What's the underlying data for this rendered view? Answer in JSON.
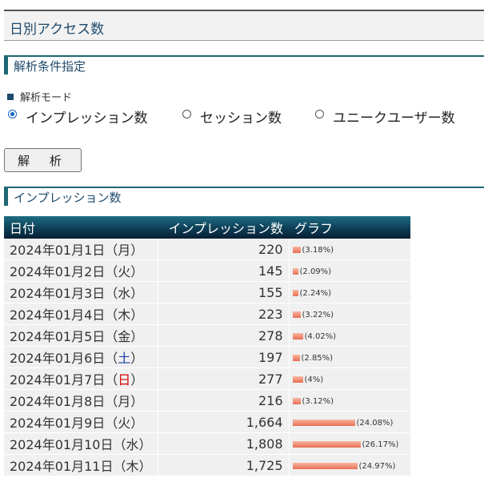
{
  "header": {
    "title": "日別アクセス数"
  },
  "conditions": {
    "heading": "解析条件指定",
    "mode_label": "解析モード",
    "modes": [
      {
        "label": "インプレッション数",
        "checked": true
      },
      {
        "label": "セッション数",
        "checked": false
      },
      {
        "label": "ユニークユーザー数",
        "checked": false
      }
    ],
    "analyze_button": "解 析"
  },
  "results": {
    "heading": "インプレッション数",
    "columns": [
      "日付",
      "インプレッション数",
      "グラフ"
    ],
    "rows": [
      {
        "date": "2024年01月1日（",
        "dow": "月",
        "dow_type": "weekday",
        "close": "）",
        "value": "220",
        "pct_text": "(3.18%)",
        "pct": 3.18
      },
      {
        "date": "2024年01月2日（",
        "dow": "火",
        "dow_type": "weekday",
        "close": "）",
        "value": "145",
        "pct_text": "(2.09%)",
        "pct": 2.09
      },
      {
        "date": "2024年01月3日（",
        "dow": "水",
        "dow_type": "weekday",
        "close": "）",
        "value": "155",
        "pct_text": "(2.24%)",
        "pct": 2.24
      },
      {
        "date": "2024年01月4日（",
        "dow": "木",
        "dow_type": "weekday",
        "close": "）",
        "value": "223",
        "pct_text": "(3.22%)",
        "pct": 3.22
      },
      {
        "date": "2024年01月5日（",
        "dow": "金",
        "dow_type": "weekday",
        "close": "）",
        "value": "278",
        "pct_text": "(4.02%)",
        "pct": 4.02
      },
      {
        "date": "2024年01月6日（",
        "dow": "土",
        "dow_type": "saturday",
        "close": "）",
        "value": "197",
        "pct_text": "(2.85%)",
        "pct": 2.85
      },
      {
        "date": "2024年01月7日（",
        "dow": "日",
        "dow_type": "sunday",
        "close": "）",
        "value": "277",
        "pct_text": "(4%)",
        "pct": 4.0
      },
      {
        "date": "2024年01月8日（",
        "dow": "月",
        "dow_type": "weekday",
        "close": "）",
        "value": "216",
        "pct_text": "(3.12%)",
        "pct": 3.12
      },
      {
        "date": "2024年01月9日（",
        "dow": "火",
        "dow_type": "weekday",
        "close": "）",
        "value": "1,664",
        "pct_text": "(24.08%)",
        "pct": 24.08
      },
      {
        "date": "2024年01月10日（",
        "dow": "水",
        "dow_type": "weekday",
        "close": "）",
        "value": "1,808",
        "pct_text": "(26.17%)",
        "pct": 26.17
      },
      {
        "date": "2024年01月11日（",
        "dow": "木",
        "dow_type": "weekday",
        "close": "）",
        "value": "1,725",
        "pct_text": "(24.97%)",
        "pct": 24.97
      }
    ]
  }
}
